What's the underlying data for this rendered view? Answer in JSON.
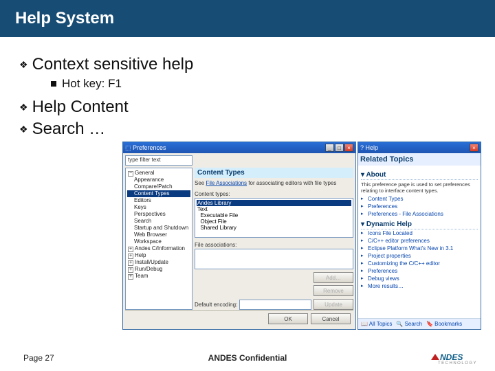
{
  "title": "Help  System",
  "bullets": {
    "b1": "Context sensitive help",
    "b1a": "Hot key: F1",
    "b2": "Help Content",
    "b3": "Search …"
  },
  "prefs": {
    "window_title": "Preferences",
    "filter": "type filter text",
    "tree": {
      "general": "General",
      "appearance": "Appearance",
      "compare": "Compare/Patch",
      "content": "Content Types",
      "editors": "Editors",
      "keys": "Keys",
      "perspectives": "Perspectives",
      "search": "Search",
      "startup": "Startup and Shutdown",
      "webbrowser": "Web Browser",
      "workspace": "Workspace",
      "andes": "Andes C/Information",
      "help": "Help",
      "install": "Install/Update",
      "rundebug": "Run/Debug",
      "team": "Team"
    },
    "panel": {
      "heading": "Content Types",
      "desc_pre": "See ",
      "desc_link": "File Associations",
      "desc_post": " for associating editors with file types",
      "list_label": "Content types:",
      "list": {
        "sel": "Andes Library",
        "text": "Text",
        "exe": "Executable File",
        "obj": "Object File",
        "shared": "Shared Library"
      },
      "file_assoc": "File associations:",
      "default_enc": "Default encoding:",
      "btn_add": "Add…",
      "btn_remove": "Remove",
      "btn_update": "Update",
      "btn_ok": "OK",
      "btn_cancel": "Cancel"
    }
  },
  "help": {
    "window_title": "Help",
    "banner": "Related Topics",
    "about": "About",
    "about_text": "This preference page is used to set preferences relating to interface content types.",
    "links1": {
      "a": "Content Types",
      "b": "Preferences",
      "c": "Preferences - File Associations"
    },
    "dynamic": "Dynamic Help",
    "links2": {
      "a": "Icons File Located",
      "b": "C/C++ editor preferences",
      "c": "Eclipse Platform What's New in 3.1",
      "d": "Project properties",
      "e": "Customizing the C/C++ editor",
      "f": "Preferences",
      "g": "Debug views",
      "h": "More results…"
    },
    "footer": {
      "all": "All Topics",
      "search": "Search",
      "bookmarks": "Bookmarks"
    }
  },
  "footer": {
    "page": "Page 27",
    "center": "ANDES Confidential",
    "brand": "NDES",
    "sub": "TECHNOLOGY"
  }
}
